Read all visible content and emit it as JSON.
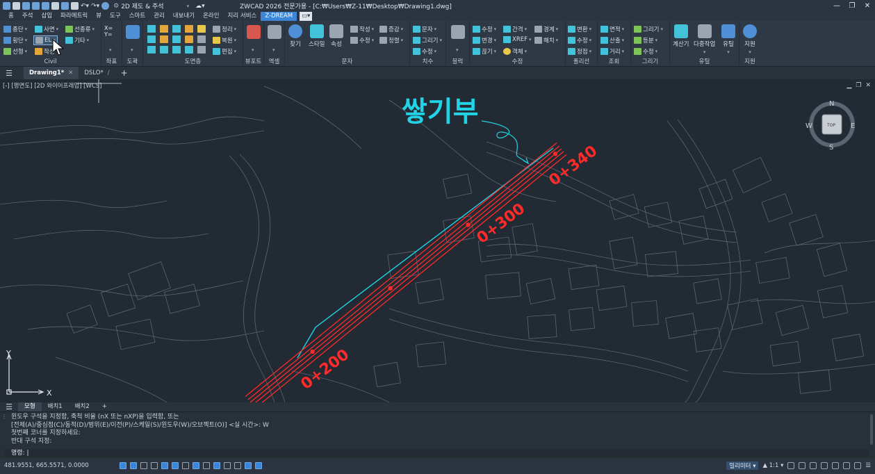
{
  "titlebar": {
    "workspace": "2D 제도 & 주석",
    "title": "ZWCAD 2026 전문가용 - [C:₩Users₩Z-11₩Desktop₩Drawing1.dwg]"
  },
  "menu": [
    "홈",
    "주석",
    "삽입",
    "파라메트릭",
    "뷰",
    "도구",
    "스마트",
    "관리",
    "내보내기",
    "온라인",
    "지리 서비스",
    "Z-DREAM"
  ],
  "menu_active": "Z-DREAM",
  "ribbon": {
    "civil": {
      "title": "Civil",
      "items": [
        "종단",
        "사면",
        "선종류",
        "횡단",
        "EL",
        "기타",
        "선형",
        "작성"
      ]
    },
    "coord": {
      "title": "좌표",
      "label": "X= / Y="
    },
    "dogak": {
      "title": "도곽"
    },
    "drawing_mgmt": {
      "title": "도면층",
      "items": [
        "정리",
        "복원",
        "편집"
      ]
    },
    "viewport": {
      "title": "뷰포트"
    },
    "excel": {
      "title": "엑셀"
    },
    "text": {
      "title": "문자",
      "items": [
        "찾기",
        "스타일",
        "속성",
        "작성",
        "수정",
        "증감",
        "정렬"
      ]
    },
    "dim": {
      "title": "치수",
      "items": [
        "문자",
        "그리기",
        "수정"
      ]
    },
    "block": {
      "title": "블럭"
    },
    "modify": {
      "title": "수정",
      "items": [
        "수정",
        "간격",
        "경계",
        "변경",
        "XREF",
        "해치",
        "끊기",
        "객체"
      ]
    },
    "polyline": {
      "title": "폴리선",
      "items": [
        "변환",
        "수정",
        "정점"
      ]
    },
    "inquiry": {
      "title": "조회",
      "items": [
        "면적",
        "산출",
        "거리"
      ]
    },
    "draw": {
      "title": "그리기",
      "items": [
        "그리기",
        "등분",
        "수정"
      ]
    },
    "util": {
      "title": "유틸",
      "items": [
        "계산기",
        "다중작업",
        "유틸"
      ]
    },
    "support": {
      "title": "지원",
      "items": [
        "지원"
      ]
    }
  },
  "doc_tabs": [
    "Drawing1*",
    "DSLO*"
  ],
  "viewport": {
    "label": "[-] [평면도] [2D 와이어프레임] [WCS]",
    "annotation": "쌓기부",
    "stations": [
      "0+340",
      "0+300",
      "0+200"
    ],
    "viewcube": {
      "top": "TOP",
      "n": "N",
      "s": "S",
      "e": "E",
      "w": "W"
    },
    "ucs": {
      "x": "X",
      "y": "Y"
    },
    "colors": {
      "road": "#ff2a2a",
      "fill_line": "#22d3e6",
      "background": "#222a33",
      "base_map": "#5d6671"
    }
  },
  "layout_tabs": [
    "모형",
    "배치1",
    "배치2"
  ],
  "command": {
    "lines": [
      "윈도우 구석을 지정함, 축척 비율 (nX 또는 nXP)을 입력함, 또는",
      "[전체(A)/중심점(C)/동적(D)/범위(E)/이전(P)/스케일(S)/윈도우(W)/오브젝트(O)] <실 시간>: W",
      "첫번째 코너를 지정하세요:",
      "반대 구석 지정:"
    ],
    "prompt": "명령:"
  },
  "status": {
    "coords": "481.9551, 665.5571, 0.0000",
    "units": "밀리미터",
    "scale": "1:1"
  }
}
